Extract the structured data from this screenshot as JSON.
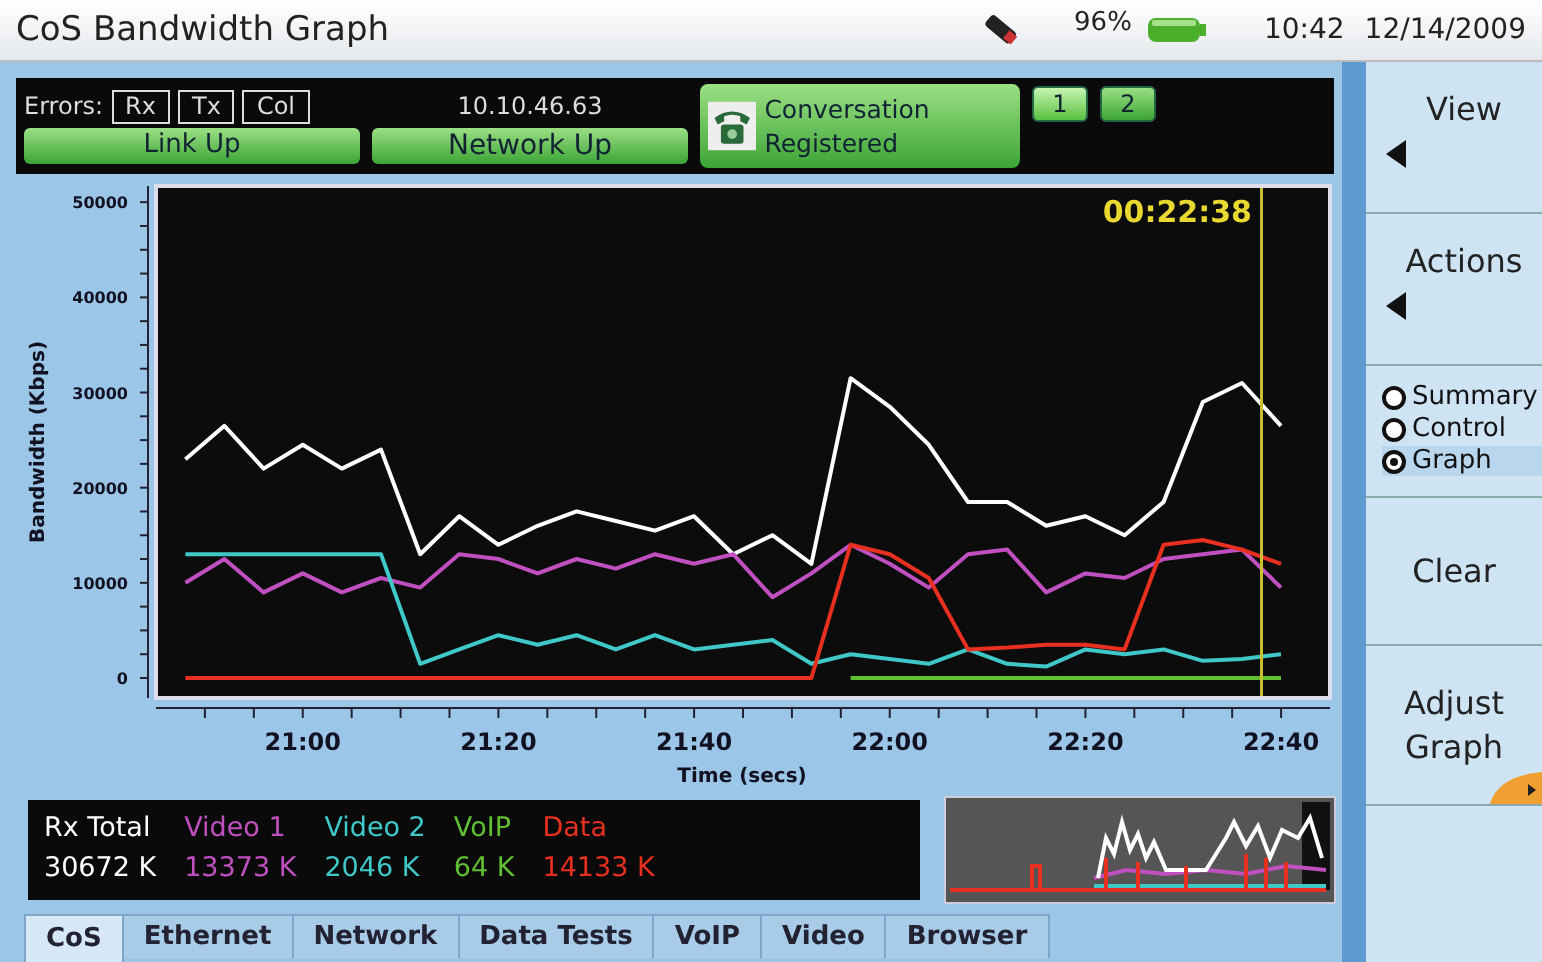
{
  "window": {
    "title": "CoS Bandwidth Graph"
  },
  "status_icons": {
    "battery": "96%",
    "time": "10:42",
    "date": "12/14/2009"
  },
  "status_strip": {
    "errors_label": "Errors:",
    "error_flags": [
      "Rx",
      "Tx",
      "Col"
    ],
    "ip": "10.10.46.63",
    "link": "Link Up",
    "network": "Network Up",
    "call": "Conversation Registered",
    "lines": [
      {
        "label": "1",
        "selected": true
      },
      {
        "label": "2",
        "selected": false
      }
    ]
  },
  "graph": {
    "chart_data": {
      "type": "line",
      "xlabel": "Time (secs)",
      "ylabel": "Bandwidth (Kbps)",
      "x": [
        1248,
        1252,
        1256,
        1260,
        1264,
        1268,
        1272,
        1276,
        1280,
        1284,
        1288,
        1292,
        1296,
        1300,
        1304,
        1308,
        1312,
        1316,
        1320,
        1324,
        1328,
        1332,
        1336,
        1340,
        1344,
        1348,
        1352,
        1356,
        1360
      ],
      "series": [
        {
          "name": "Rx Total",
          "color": "#ffffff",
          "values": [
            23000,
            26500,
            22000,
            24500,
            22000,
            24000,
            13000,
            17000,
            14000,
            16000,
            17500,
            16500,
            15500,
            17000,
            13000,
            15000,
            12000,
            31500,
            28500,
            24500,
            18500,
            18500,
            16000,
            17000,
            15000,
            18500,
            29000,
            31000,
            26500
          ]
        },
        {
          "name": "Video 1",
          "color": "#c050c0",
          "values": [
            10000,
            12500,
            9000,
            11000,
            9000,
            10500,
            9500,
            13000,
            12500,
            11000,
            12500,
            11500,
            13000,
            12000,
            13000,
            8500,
            11000,
            14000,
            12000,
            9500,
            13000,
            13500,
            9000,
            11000,
            10500,
            12500,
            13000,
            13500,
            9500
          ]
        },
        {
          "name": "Video 2",
          "color": "#40c8c8",
          "values": [
            13000,
            13000,
            13000,
            13000,
            13000,
            13000,
            1500,
            3000,
            4500,
            3500,
            4500,
            3000,
            4500,
            3000,
            3500,
            4000,
            1500,
            2500,
            2000,
            1500,
            3000,
            1500,
            1200,
            3000,
            2500,
            3000,
            1800,
            2000,
            2500
          ]
        },
        {
          "name": "VoIP",
          "color": "#60c030",
          "values": [
            null,
            null,
            null,
            null,
            null,
            null,
            null,
            null,
            null,
            null,
            null,
            null,
            null,
            null,
            null,
            null,
            null,
            0,
            0,
            0,
            0,
            0,
            0,
            0,
            0,
            0,
            0,
            0,
            0
          ]
        },
        {
          "name": "Data",
          "color": "#e83020",
          "values": [
            0,
            0,
            0,
            0,
            0,
            0,
            0,
            0,
            0,
            0,
            0,
            0,
            0,
            0,
            0,
            0,
            0,
            14000,
            13000,
            10500,
            3000,
            3200,
            3500,
            3500,
            3000,
            14000,
            14500,
            13500,
            12000
          ]
        }
      ],
      "xlim": [
        1245,
        1365
      ],
      "ylim": [
        -2100,
        51700
      ],
      "xticks": [
        {
          "value": 1260,
          "label": "21:00"
        },
        {
          "value": 1280,
          "label": "21:20"
        },
        {
          "value": 1300,
          "label": "21:40"
        },
        {
          "value": 1320,
          "label": "22:00"
        },
        {
          "value": 1340,
          "label": "22:20"
        },
        {
          "value": 1360,
          "label": "22:40"
        }
      ],
      "yticks": [
        0,
        10000,
        20000,
        30000,
        40000,
        50000
      ],
      "annotations": [
        "00:22:38"
      ],
      "ref_lines": [
        {
          "axis": "x",
          "value": 1358
        }
      ]
    }
  },
  "legend": [
    {
      "value": "30672 K"
    },
    {
      "value": "13373 K"
    },
    {
      "value": "2046 K"
    },
    {
      "value": "64 K"
    },
    {
      "value": "14133 K"
    }
  ],
  "tabs": [
    {
      "label": "CoS",
      "selected": true
    },
    {
      "label": "Ethernet",
      "selected": false
    },
    {
      "label": "Network",
      "selected": false
    },
    {
      "label": "Data Tests",
      "selected": false
    },
    {
      "label": "VoIP",
      "selected": false
    },
    {
      "label": "Video",
      "selected": false
    },
    {
      "label": "Browser",
      "selected": false
    }
  ],
  "sidebar": [
    {
      "kind": "menu",
      "label": "View"
    },
    {
      "kind": "menu",
      "label": "Actions"
    },
    {
      "kind": "radio",
      "options": [
        {
          "label": "Summary",
          "selected": false
        },
        {
          "label": "Control",
          "selected": false
        },
        {
          "label": "Graph",
          "selected": true
        }
      ]
    },
    {
      "kind": "button",
      "label": "Clear"
    },
    {
      "kind": "more",
      "label": "Adjust Graph"
    }
  ]
}
